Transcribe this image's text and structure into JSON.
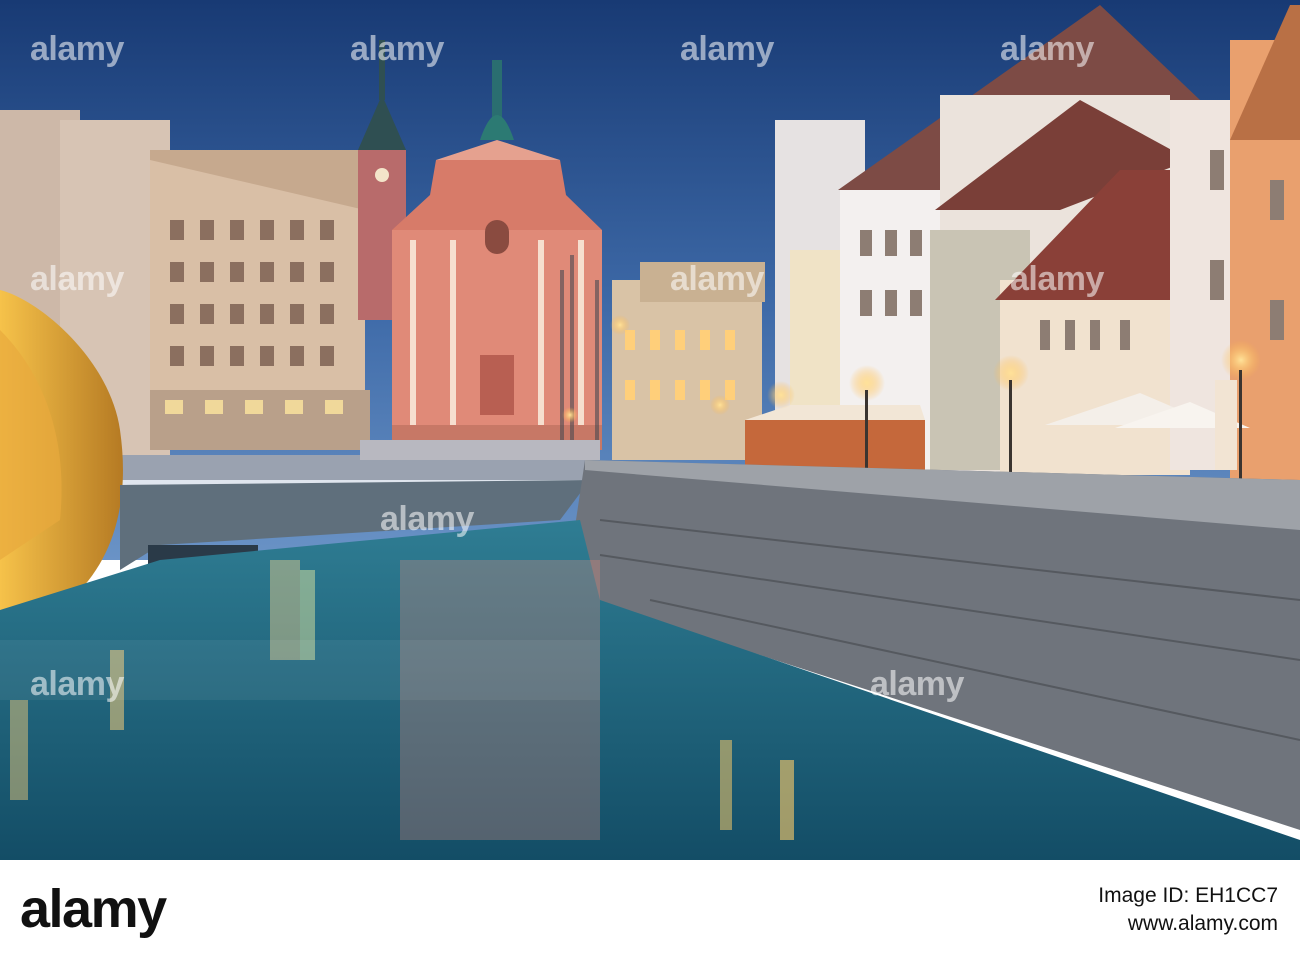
{
  "watermark": {
    "text": "alamy",
    "color": "#ffffff"
  },
  "footer": {
    "brand": "alamy",
    "stock_photo_label": "Image ID: EH1CC7",
    "site": "www.alamy.com"
  },
  "scene": {
    "sky_top": "#1d3e78",
    "sky_bottom": "#5a86bf",
    "water": "#1f5f78",
    "church_facade": "#e08a78",
    "lamp_glow": "#ffc860"
  }
}
